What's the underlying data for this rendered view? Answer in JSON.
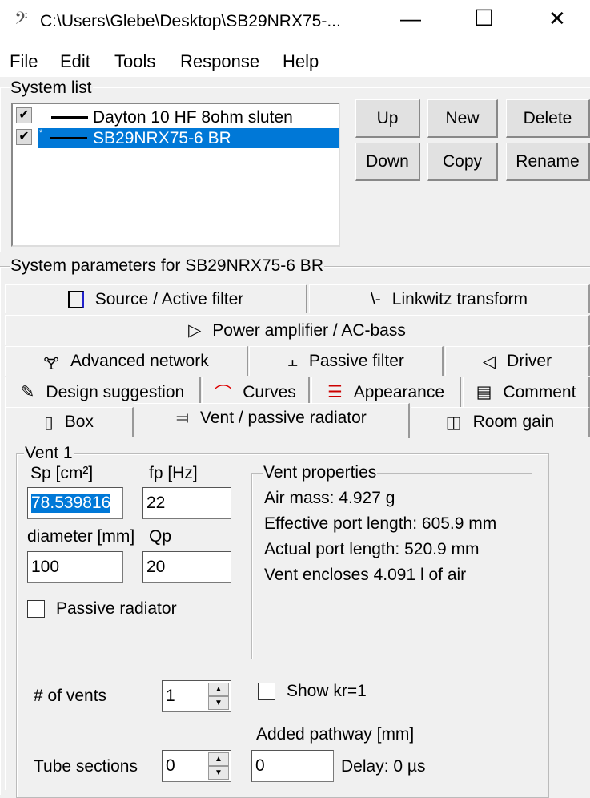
{
  "window": {
    "title": "C:\\Users\\Glebe\\Desktop\\SB29NRX75-...",
    "minimize": "—",
    "maximize": "☐",
    "close": "✕"
  },
  "menu": [
    "File",
    "Edit",
    "Tools",
    "Response",
    "Help"
  ],
  "system_list": {
    "label": "System list",
    "items": [
      {
        "name": "Dayton 10 HF 8ohm sluten",
        "checked": true,
        "selected": false,
        "marker": ""
      },
      {
        "name": "SB29NRX75-6 BR",
        "checked": true,
        "selected": true,
        "marker": "*"
      }
    ],
    "buttons": {
      "up": "Up",
      "new": "New",
      "delete": "Delete",
      "down": "Down",
      "copy": "Copy",
      "rename": "Rename"
    },
    "selection_color": "#0078d7"
  },
  "params": {
    "label": "System parameters for SB29NRX75-6 BR",
    "tabs": {
      "source": "Source / Active filter",
      "linkwitz": "Linkwitz transform",
      "power": "Power amplifier / AC-bass",
      "advanced": "Advanced network",
      "passive": "Passive filter",
      "driver": "Driver",
      "design": "Design suggestion",
      "curves": "Curves",
      "appearance": "Appearance",
      "comment": "Comment",
      "box": "Box",
      "vent": "Vent / passive radiator",
      "room": "Room gain"
    },
    "active_tab": "Vent / passive radiator"
  },
  "vent": {
    "group_label": "Vent 1",
    "sp_label": "Sp [cm²]",
    "sp_value": "78.539816",
    "fp_label": "fp [Hz]",
    "fp_value": "22",
    "diameter_label": "diameter [mm]",
    "diameter_value": "100",
    "qp_label": "Qp",
    "qp_value": "20",
    "passive_radiator_label": "Passive radiator",
    "passive_radiator_checked": false,
    "properties": {
      "label": "Vent properties",
      "lines": [
        "Air mass: 4.927 g",
        "Effective port length: 605.9 mm",
        "Actual port length: 520.9 mm",
        "Vent encloses 4.091 l of air"
      ]
    },
    "num_vents_label": "# of vents",
    "num_vents_value": "1",
    "show_kr_label": "Show kr=1",
    "show_kr_checked": false,
    "added_pathway_label": "Added pathway [mm]",
    "added_pathway_value": "0",
    "tube_sections_label": "Tube sections",
    "tube_sections_value": "0",
    "delay": "Delay: 0 µs"
  }
}
